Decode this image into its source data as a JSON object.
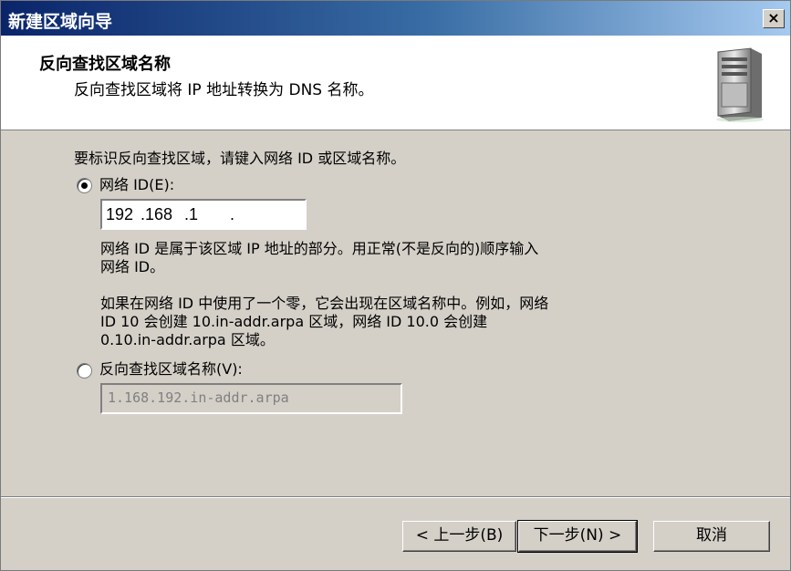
{
  "window": {
    "title": "新建区域向导",
    "close_label": "×"
  },
  "header": {
    "title": "反向查找区域名称",
    "subtitle": "反向查找区域将 IP 地址转换为 DNS 名称。"
  },
  "body": {
    "instruction": "要标识反向查找区域，请键入网络 ID 或区域名称。",
    "option_network_id": {
      "label": "网络 ID(E):",
      "checked": true
    },
    "ip_input": {
      "seg1": "192",
      "seg2": ".168",
      "seg3": ".1",
      "seg4": "."
    },
    "network_id_help_line1": "网络 ID 是属于该区域 IP 地址的部分。用正常(不是反向的)顺序输入",
    "network_id_help_line2": "网络 ID。",
    "zero_help_line1": "如果在网络 ID 中使用了一个零，它会出现在区域名称中。例如，网络",
    "zero_help_line2": "ID 10 会创建 10.in-addr.arpa 区域，网络 ID 10.0 会创建",
    "zero_help_line3": "0.10.in-addr.arpa 区域。",
    "option_zone_name": {
      "label": "反向查找区域名称(V):",
      "checked": false
    },
    "zone_name_value": "1.168.192.in-addr.arpa"
  },
  "buttons": {
    "back": "< 上一步(B)",
    "next": "下一步(N) >",
    "cancel": "取消"
  },
  "icons": {
    "header_icon": "server-icon"
  }
}
